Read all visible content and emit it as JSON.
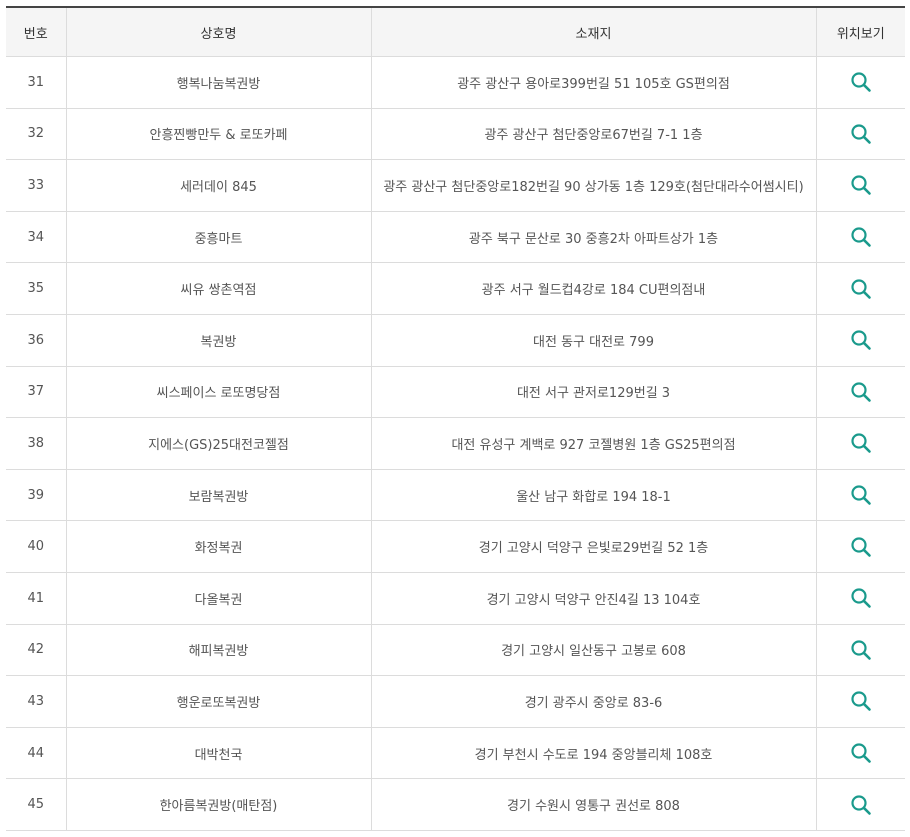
{
  "table": {
    "headers": {
      "number": "번호",
      "name": "상호명",
      "address": "소재지",
      "location": "위치보기"
    },
    "icon": "search-icon",
    "icon_color": "#1a9a8c",
    "rows": [
      {
        "number": "31",
        "name": "행복나눔복권방",
        "address": "광주 광산구 용아로399번길 51 105호 GS편의점"
      },
      {
        "number": "32",
        "name": "안흥찐빵만두 & 로또카페",
        "address": "광주 광산구 첨단중앙로67번길 7-1 1층"
      },
      {
        "number": "33",
        "name": "세러데이 845",
        "address": "광주 광산구 첨단중앙로182번길 90 상가동 1층 129호(첨단대라수어썸시티)"
      },
      {
        "number": "34",
        "name": "중흥마트",
        "address": "광주 북구 문산로 30 중흥2차 아파트상가 1층"
      },
      {
        "number": "35",
        "name": "씨유 쌍촌역점",
        "address": "광주 서구 월드컵4강로 184 CU편의점내"
      },
      {
        "number": "36",
        "name": "복권방",
        "address": "대전 동구 대전로 799"
      },
      {
        "number": "37",
        "name": "씨스페이스 로또명당점",
        "address": "대전 서구 관저로129번길 3"
      },
      {
        "number": "38",
        "name": "지에스(GS)25대전코젤점",
        "address": "대전 유성구 계백로 927 코젤병원 1층 GS25편의점"
      },
      {
        "number": "39",
        "name": "보람복권방",
        "address": "울산 남구 화합로 194 18-1"
      },
      {
        "number": "40",
        "name": "화정복권",
        "address": "경기 고양시 덕양구 은빛로29번길 52 1층"
      },
      {
        "number": "41",
        "name": "다올복권",
        "address": "경기 고양시 덕양구 안진4길 13 104호"
      },
      {
        "number": "42",
        "name": "해피복권방",
        "address": "경기 고양시 일산동구 고봉로 608"
      },
      {
        "number": "43",
        "name": "행운로또복권방",
        "address": "경기 광주시 중앙로 83-6"
      },
      {
        "number": "44",
        "name": "대박천국",
        "address": "경기 부천시 수도로 194 중앙블리체 108호"
      },
      {
        "number": "45",
        "name": "한아름복권방(매탄점)",
        "address": "경기 수원시 영통구 권선로 808"
      }
    ]
  }
}
